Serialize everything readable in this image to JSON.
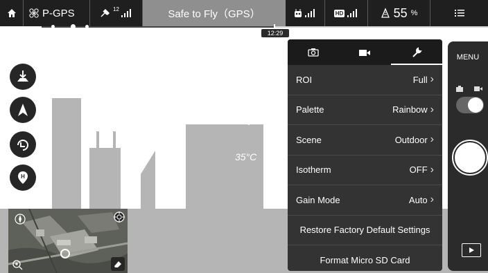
{
  "topbar": {
    "home_icon": "home-icon",
    "flight_mode": "P-GPS",
    "gps_satellites": "12",
    "status_text": "Safe to Fly（GPS）",
    "rc_icon": "remote-controller-icon",
    "hd_label": "HD",
    "battery_percent": "55",
    "battery_unit": "%",
    "menu_icon": "list-menu-icon"
  },
  "timeline": {
    "time": "12:29"
  },
  "overlay": {
    "temperature": "35°C"
  },
  "left_controls": [
    "auto-takeoff-icon",
    "navigation-arrow-icon",
    "return-home-icon",
    "waypoint-h-icon"
  ],
  "settings_panel": {
    "tabs": [
      {
        "id": "camera",
        "icon": "camera-icon",
        "active": false
      },
      {
        "id": "video",
        "icon": "video-icon",
        "active": false
      },
      {
        "id": "wrench",
        "icon": "wrench-icon",
        "active": true
      }
    ],
    "rows": [
      {
        "label": "ROI",
        "value": "Full"
      },
      {
        "label": "Palette",
        "value": "Rainbow"
      },
      {
        "label": "Scene",
        "value": "Outdoor"
      },
      {
        "label": "Isotherm",
        "value": "OFF"
      },
      {
        "label": "Gain Mode",
        "value": "Auto"
      }
    ],
    "actions": [
      "Restore Factory Default Settings",
      "Format Micro SD Card"
    ]
  },
  "camera_bar": {
    "menu_label": "MENU"
  },
  "colors": {
    "topbar_bg": "#1f1f1f",
    "status_bg": "#8f8f8f",
    "panel_bg": "#333333",
    "scene_gray": "#b5b5b5"
  }
}
